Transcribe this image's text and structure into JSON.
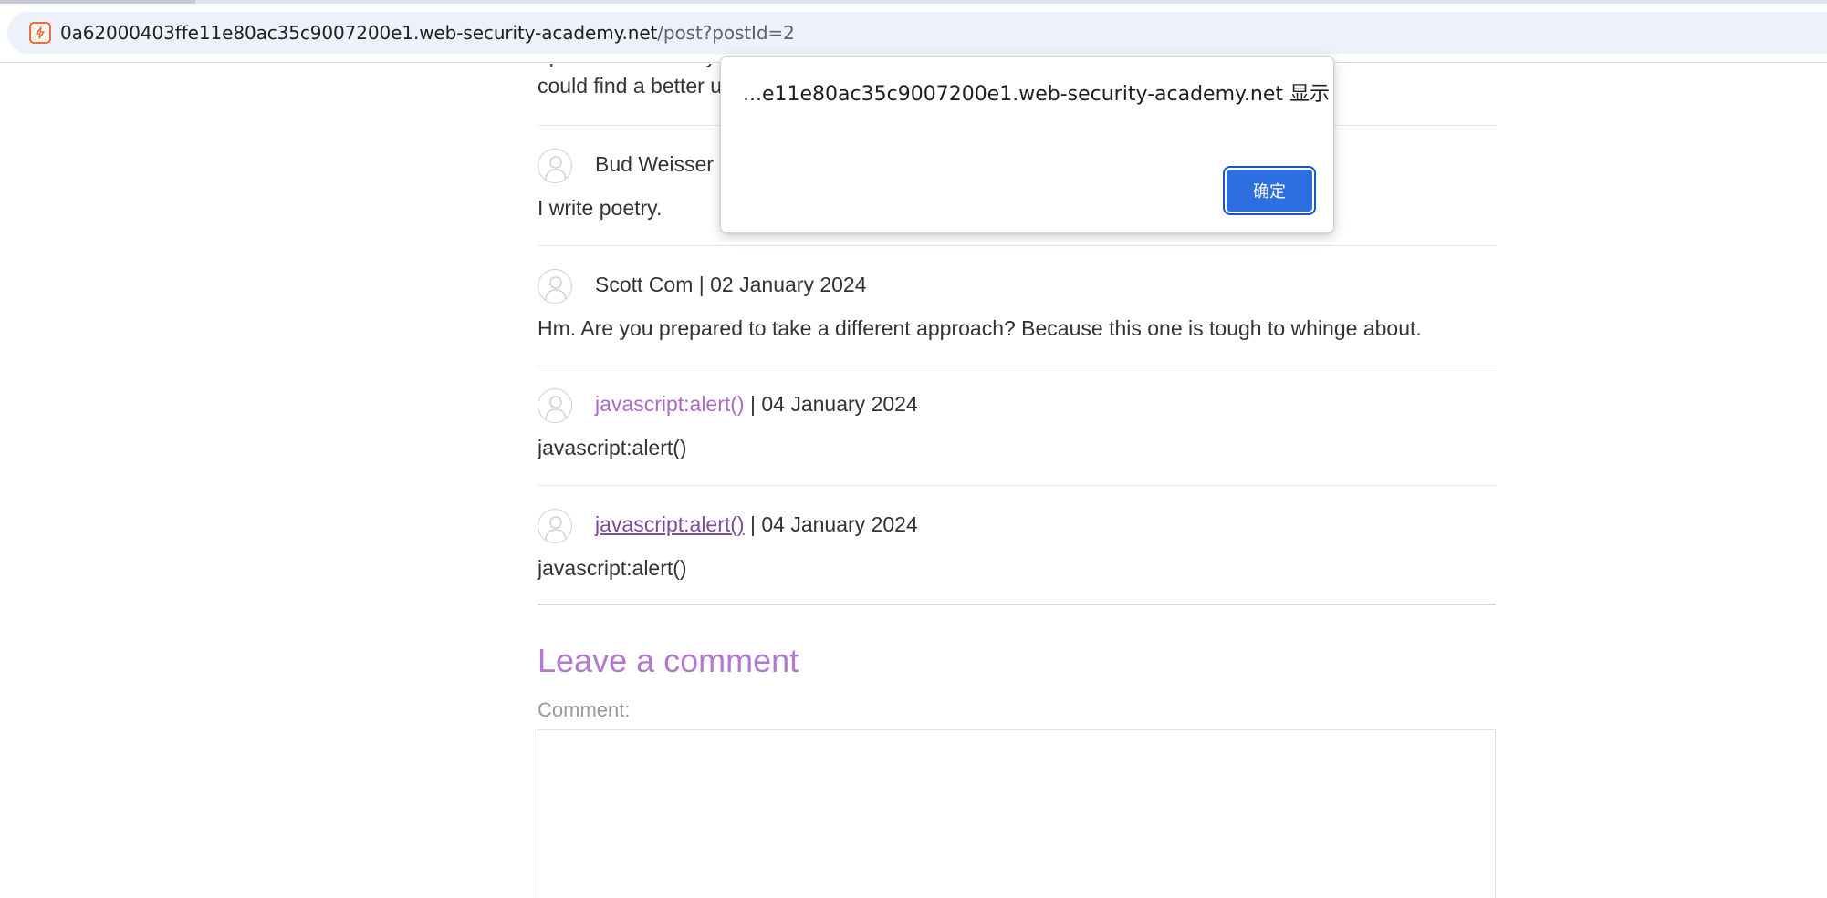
{
  "browser": {
    "url_host": "0a62000403ffe11e80ac35c9007200e1.web-security-academy.net",
    "url_path": "/post?postId=2"
  },
  "comments": [
    {
      "author": "",
      "date": "",
      "text": "could find a better u",
      "partial_top_text": "I print screened my"
    },
    {
      "author": "Bud Weisser",
      "date": "",
      "text": "I write poetry."
    },
    {
      "author": "Scott Com",
      "separator": " | ",
      "date": "02 January 2024",
      "text": "Hm. Are you prepared to take a different approach? Because this one is tough to whinge about."
    },
    {
      "author": "javascript:alert()",
      "separator": " | ",
      "date": "04 January 2024",
      "text": "javascript:alert()"
    },
    {
      "author": "javascript:alert()",
      "separator": " | ",
      "date": "04 January 2024",
      "text": "javascript:alert()"
    }
  ],
  "leave_comment": {
    "title": "Leave a comment",
    "comment_label": "Comment:",
    "comment_value": ""
  },
  "alert_dialog": {
    "message": "...e11e80ac35c9007200e1.web-security-academy.net 显示",
    "ok_label": "确定"
  },
  "colors": {
    "link": "#a96bc8",
    "heading": "#b179cf",
    "dialog_button": "#2d6ee0",
    "site_icon": "#e8703a"
  },
  "icons": {
    "site": "lab-favicon-icon",
    "avatar": "user-avatar-icon"
  }
}
